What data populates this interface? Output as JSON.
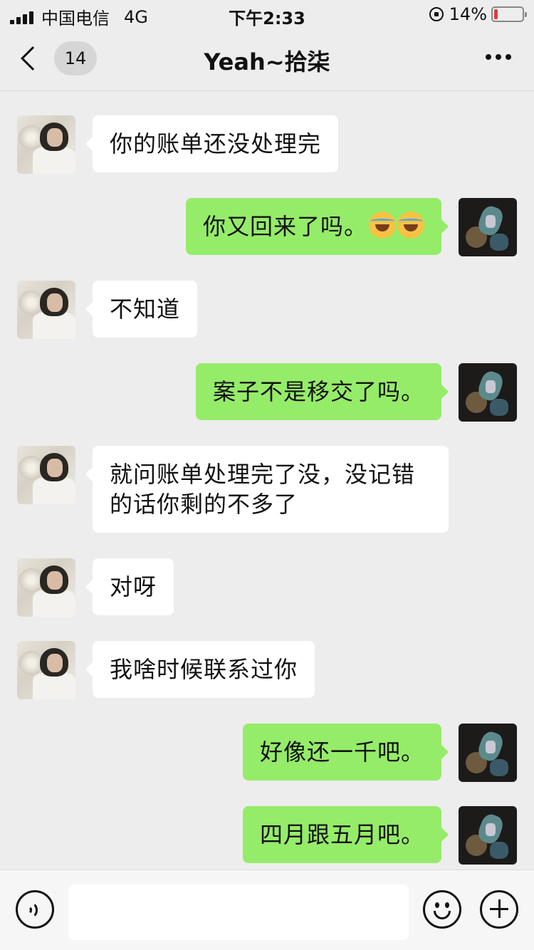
{
  "status_bar": {
    "carrier": "中国电信",
    "network": "4G",
    "time": "下午2:33",
    "battery": "14%",
    "battery_level": 0.14
  },
  "nav": {
    "unread_count": "14",
    "title": "Yeah~拾柒"
  },
  "messages": [
    {
      "side": "in",
      "text": "你的账单还没处理完"
    },
    {
      "side": "out",
      "text": "你又回来了吗。",
      "emoji": [
        "joy-emoji",
        "joy-emoji"
      ]
    },
    {
      "side": "in",
      "text": "不知道"
    },
    {
      "side": "out",
      "text": "案子不是移交了吗。"
    },
    {
      "side": "in",
      "text": "就问账单处理完了没，没记错的话你剩的不多了"
    },
    {
      "side": "in",
      "text": "对呀"
    },
    {
      "side": "in",
      "text": "我啥时候联系过你"
    },
    {
      "side": "out",
      "text": "好像还一千吧。"
    },
    {
      "side": "out",
      "text": "四月跟五月吧。"
    }
  ],
  "input_bar": {
    "placeholder": ""
  },
  "colors": {
    "background": "#ededed",
    "outgoing_bubble": "#95ec69",
    "incoming_bubble": "#ffffff",
    "battery_low": "#e53935"
  }
}
